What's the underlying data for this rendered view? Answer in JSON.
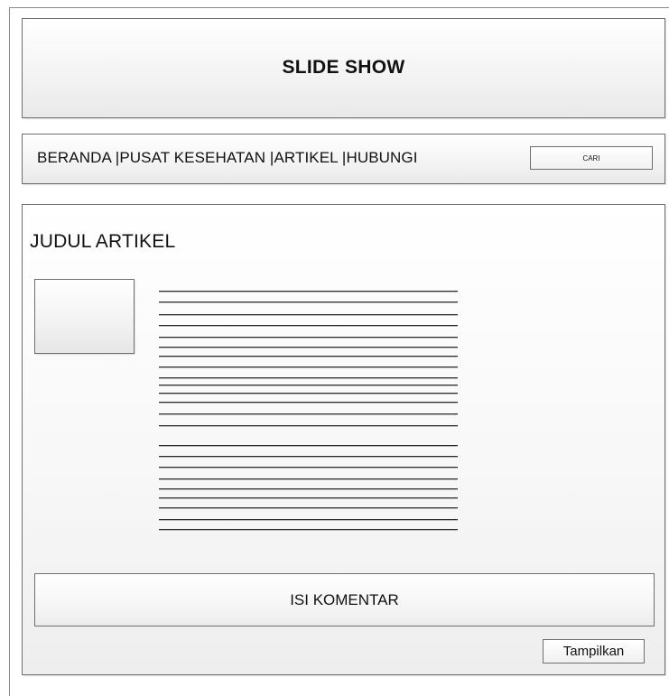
{
  "header": {
    "slideshow_title": "SLIDE SHOW"
  },
  "nav": {
    "items": [
      {
        "label": "BERANDA "
      },
      {
        "label": "PUSAT KESEHATAN "
      },
      {
        "label": "ARTIKEL "
      },
      {
        "label": "HUBUNGI"
      }
    ],
    "separator": "|",
    "search_label": "CARI"
  },
  "article": {
    "title": "JUDUL ARTIKEL"
  },
  "comments": {
    "input_label": "ISI KOMENTAR",
    "show_button_label": "Tampilkan"
  }
}
